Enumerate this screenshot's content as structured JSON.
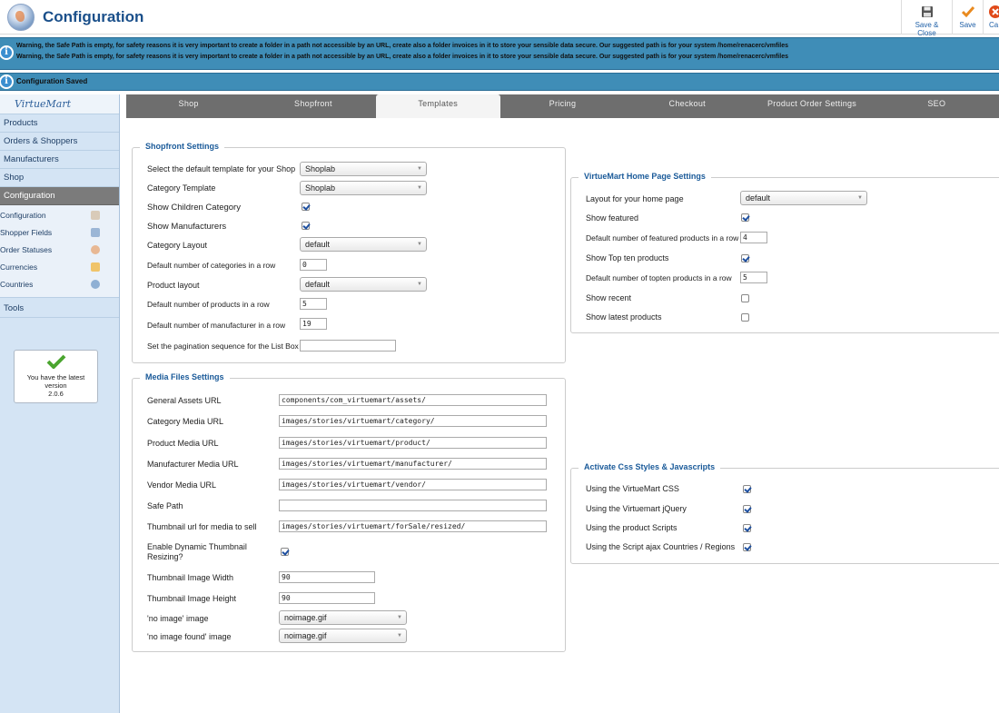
{
  "header": {
    "title": "Configuration",
    "toolbar": {
      "save_close": "Save & Close",
      "save": "Save",
      "cancel": "Ca"
    }
  },
  "warnings": [
    "Warning, the Safe Path is empty, for safety reasons it is very important to create a folder in a path not accessible by an URL, create also a folder invoices in it to store your sensible data secure. Our suggested path is for your system /home/renacerc/vmfiles",
    "Warning, the Safe Path is empty, for safety reasons it is very important to create a folder in a path not accessible by an URL, create also a folder invoices in it to store your sensible data secure. Our suggested path is for your system /home/renacerc/vmfiles"
  ],
  "saved_message": "Configuration Saved",
  "sidebar": {
    "logo": "VirtueMart",
    "items": [
      "Products",
      "Orders & Shoppers",
      "Manufacturers",
      "Shop",
      "Configuration"
    ],
    "sub_items": [
      "Configuration",
      "Shopper Fields",
      "Order Statuses",
      "Currencies",
      "Countries"
    ],
    "tools": "Tools",
    "version": {
      "line1": "You have the latest",
      "line2": "version",
      "line3": "2.0.6"
    }
  },
  "tabs": [
    "Shop",
    "Shopfront",
    "Templates",
    "Pricing",
    "Checkout",
    "Product Order Settings",
    "SEO"
  ],
  "shopfront": {
    "legend": "Shopfront Settings",
    "default_template_label": "Select the default template for your Shop",
    "default_template_value": "Shoplab",
    "category_template_label": "Category Template",
    "category_template_value": "Shoplab",
    "show_children_label": "Show Children Category",
    "show_children": true,
    "show_manufacturers_label": "Show Manufacturers",
    "show_manufacturers": true,
    "category_layout_label": "Category Layout",
    "category_layout_value": "default",
    "categories_row_label": "Default number of categories in a row",
    "categories_row_value": "0",
    "product_layout_label": "Product layout",
    "product_layout_value": "default",
    "products_row_label": "Default number of products in a row",
    "products_row_value": "5",
    "manufacturer_row_label": "Default number of manufacturer in a row",
    "manufacturer_row_value": "19",
    "pagination_label": "Set the pagination sequence for the List Box",
    "pagination_value": ""
  },
  "media": {
    "legend": "Media Files Settings",
    "general_assets_label": "General Assets URL",
    "general_assets_value": "components/com_virtuemart/assets/",
    "category_media_label": "Category Media URL",
    "category_media_value": "images/stories/virtuemart/category/",
    "product_media_label": "Product Media URL",
    "product_media_value": "images/stories/virtuemart/product/",
    "manufacturer_media_label": "Manufacturer Media URL",
    "manufacturer_media_value": "images/stories/virtuemart/manufacturer/",
    "vendor_media_label": "Vendor Media URL",
    "vendor_media_value": "images/stories/virtuemart/vendor/",
    "safe_path_label": "Safe Path",
    "safe_path_value": "",
    "thumb_url_label": "Thumbnail url for media to sell",
    "thumb_url_value": "images/stories/virtuemart/forSale/resized/",
    "dynamic_thumb_label1": "Enable Dynamic Thumbnail",
    "dynamic_thumb_label2": "Resizing?",
    "dynamic_thumb": true,
    "thumb_width_label": "Thumbnail Image Width",
    "thumb_width_value": "90",
    "thumb_height_label": "Thumbnail Image Height",
    "thumb_height_value": "90",
    "no_image_label": "'no image' image",
    "no_image_value": "noimage.gif",
    "no_image_found_label": "'no image found' image",
    "no_image_found_value": "noimage.gif"
  },
  "home": {
    "legend": "VirtueMart Home Page Settings",
    "layout_label": "Layout for your home page",
    "layout_value": "default",
    "show_featured_label": "Show featured",
    "show_featured": true,
    "featured_row_label": "Default number of featured products in a row",
    "featured_row_value": "4",
    "show_topten_label": "Show Top ten products",
    "show_topten": true,
    "topten_row_label": "Default number of topten products in a row",
    "topten_row_value": "5",
    "show_recent_label": "Show recent",
    "show_recent": false,
    "show_latest_label": "Show latest products",
    "show_latest": false
  },
  "css": {
    "legend": "Activate Css Styles & Javascripts",
    "vm_css_label": "Using the VirtueMart CSS",
    "vm_jquery_label": "Using the Virtuemart jQuery",
    "product_scripts_label": "Using the product Scripts",
    "ajax_label": "Using the Script ajax Countries / Regions"
  }
}
